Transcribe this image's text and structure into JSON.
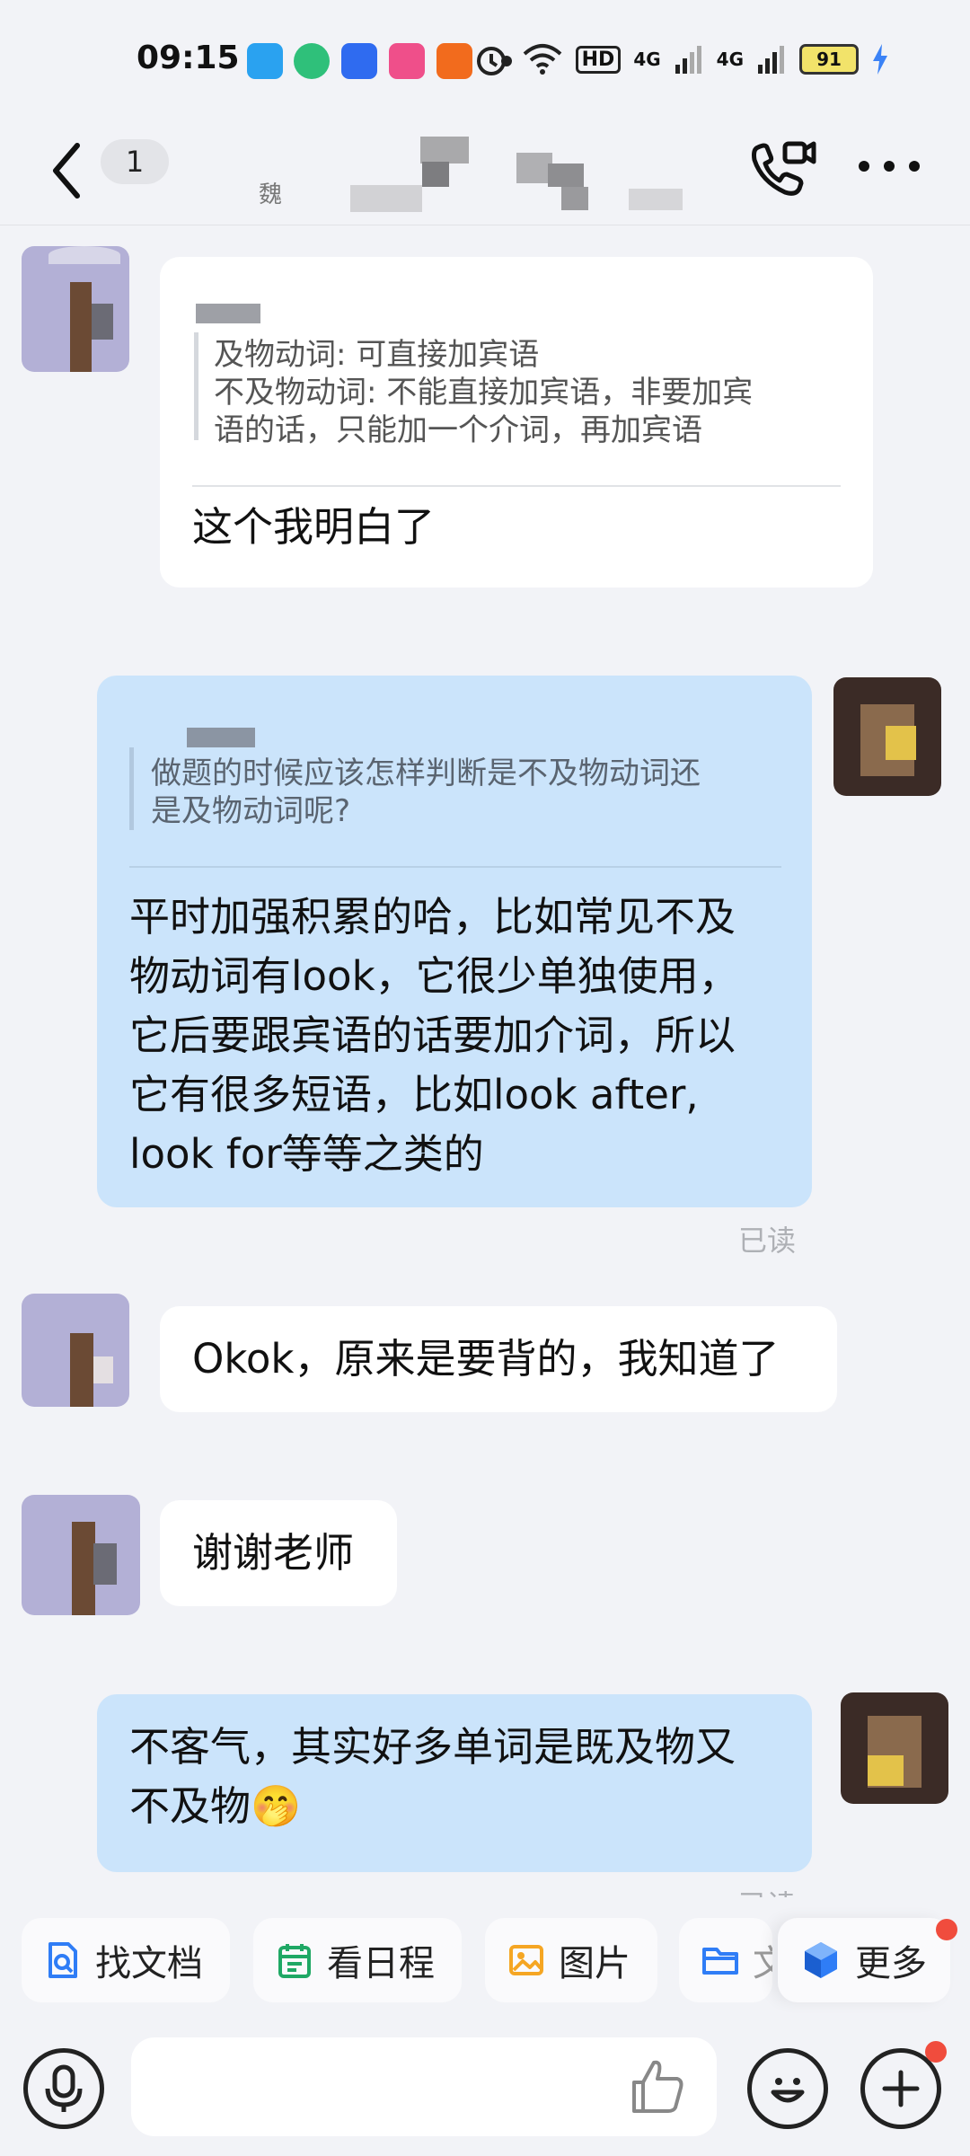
{
  "status_bar": {
    "time": "09:15",
    "network_1": "4G",
    "network_2": "4G",
    "hd_label": "HD",
    "battery": "91",
    "icons": [
      "telegram-like-icon",
      "video-app-icon",
      "baidu-icon",
      "app-icon",
      "taobao-icon",
      "dot-icon",
      "alarm-icon",
      "wifi-icon",
      "hd-icon",
      "signal-icon",
      "signal-icon",
      "battery-icon",
      "charging-icon"
    ]
  },
  "header": {
    "unread_count": "1",
    "subtitle_char": "魏",
    "colors": {
      "background": "#f2f3f7"
    }
  },
  "messages": [
    {
      "direction": "in",
      "quote": "及物动词: 可直接加宾语\n不及物动词: 不能直接加宾语，非要加宾\n语的话，只能加一个介词，再加宾语",
      "text": "这个我明白了"
    },
    {
      "direction": "out",
      "quote": "做题的时候应该怎样判断是不及物动词还\n是及物动词呢?",
      "text": "平时加强积累的哈，比如常见不及\n物动词有look，它很少单独使用，\n它后要跟宾语的话要加介词，所以\n它有很多短语，比如look after,\nlook for等等之类的",
      "status": "已读"
    },
    {
      "direction": "in",
      "text": "Okok，原来是要背的，我知道了"
    },
    {
      "direction": "in",
      "text": "谢谢老师"
    },
    {
      "direction": "out",
      "text": "不客气，其实好多单词是既及物又\n不及物🤭",
      "status": "已读"
    }
  ],
  "quick_actions": [
    {
      "label": "找文档",
      "icon": "doc-search-icon",
      "color": "#2f7df6"
    },
    {
      "label": "看日程",
      "icon": "calendar-icon",
      "color": "#1fa865"
    },
    {
      "label": "图片",
      "icon": "image-icon",
      "color": "#f5a623"
    },
    {
      "label": "文",
      "icon": "folder-icon",
      "color": "#2f7df6"
    },
    {
      "label": "更多",
      "icon": "cube-icon",
      "color": "#2f7df6"
    }
  ],
  "input_bar": {
    "icons": [
      "voice-icon",
      "thumbs-up-icon",
      "emoji-icon",
      "plus-icon"
    ]
  }
}
